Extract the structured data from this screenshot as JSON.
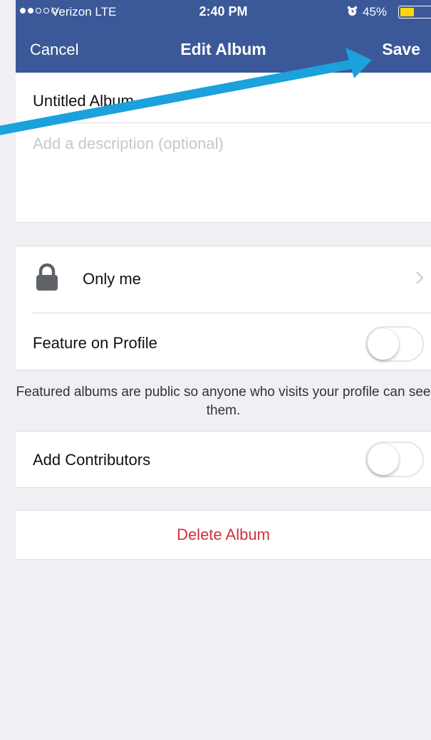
{
  "status_bar": {
    "carrier": "Verizon  LTE",
    "time": "2:40 PM",
    "battery_percent": "45%",
    "battery_level": 0.45,
    "signal_bars": 2,
    "icons": [
      "signal-dots-icon",
      "alarm-icon",
      "battery-icon"
    ]
  },
  "nav": {
    "cancel_label": "Cancel",
    "title": "Edit Album",
    "save_label": "Save"
  },
  "album": {
    "name_value": "Untitled Album",
    "description_placeholder": "Add a description (optional)"
  },
  "privacy": {
    "label": "Only me",
    "icon": "lock-icon"
  },
  "feature_on_profile": {
    "label": "Feature on Profile",
    "enabled": false,
    "note": "Featured albums are public so anyone who visits your profile can see them."
  },
  "contributors": {
    "label": "Add Contributors",
    "enabled": false
  },
  "delete_label": "Delete Album",
  "colors": {
    "header": "#3b5998",
    "background": "#efeff4",
    "delete": "#d0323b",
    "annotation_arrow": "#1ba1dc",
    "battery": "#ffd60a"
  }
}
